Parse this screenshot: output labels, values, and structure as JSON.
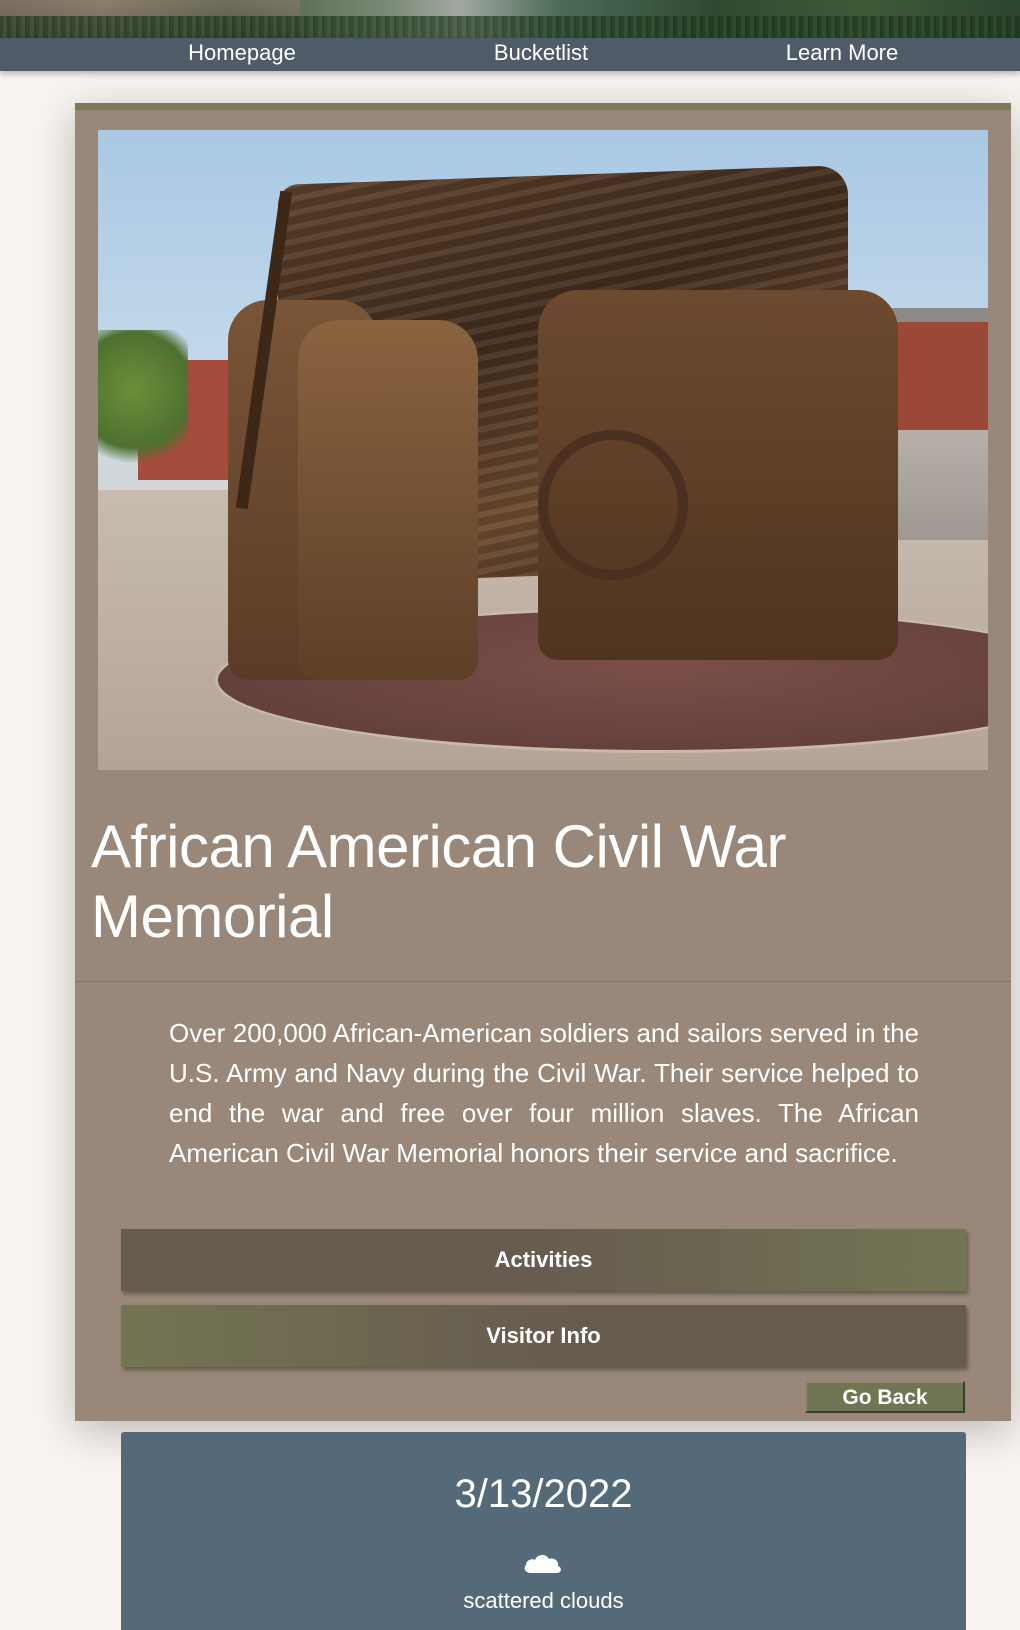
{
  "nav": {
    "home": "Homepage",
    "bucketlist": "Bucketlist",
    "learn_more": "Learn More"
  },
  "memorial": {
    "title": "African American Civil War Memorial",
    "description": "Over 200,000 African-American soldiers and sailors served in the U.S. Army and Navy during the Civil War. Their service helped to end the war and free over four million slaves. The African American Civil War Memorial honors their service and sacrifice.",
    "activities_label": "Activities",
    "visitor_info_label": "Visitor Info",
    "go_back_label": "Go Back"
  },
  "weather": {
    "date": "3/13/2022",
    "icon": "cloud-icon",
    "description": "scattered clouds"
  },
  "colors": {
    "page_bg": "#f9f4f0",
    "nav_bg": "#4f5b66",
    "card_bg": "#998879",
    "accent_olive": "#727553",
    "button_brown": "#675a4f",
    "weather_bg": "#556a79"
  }
}
